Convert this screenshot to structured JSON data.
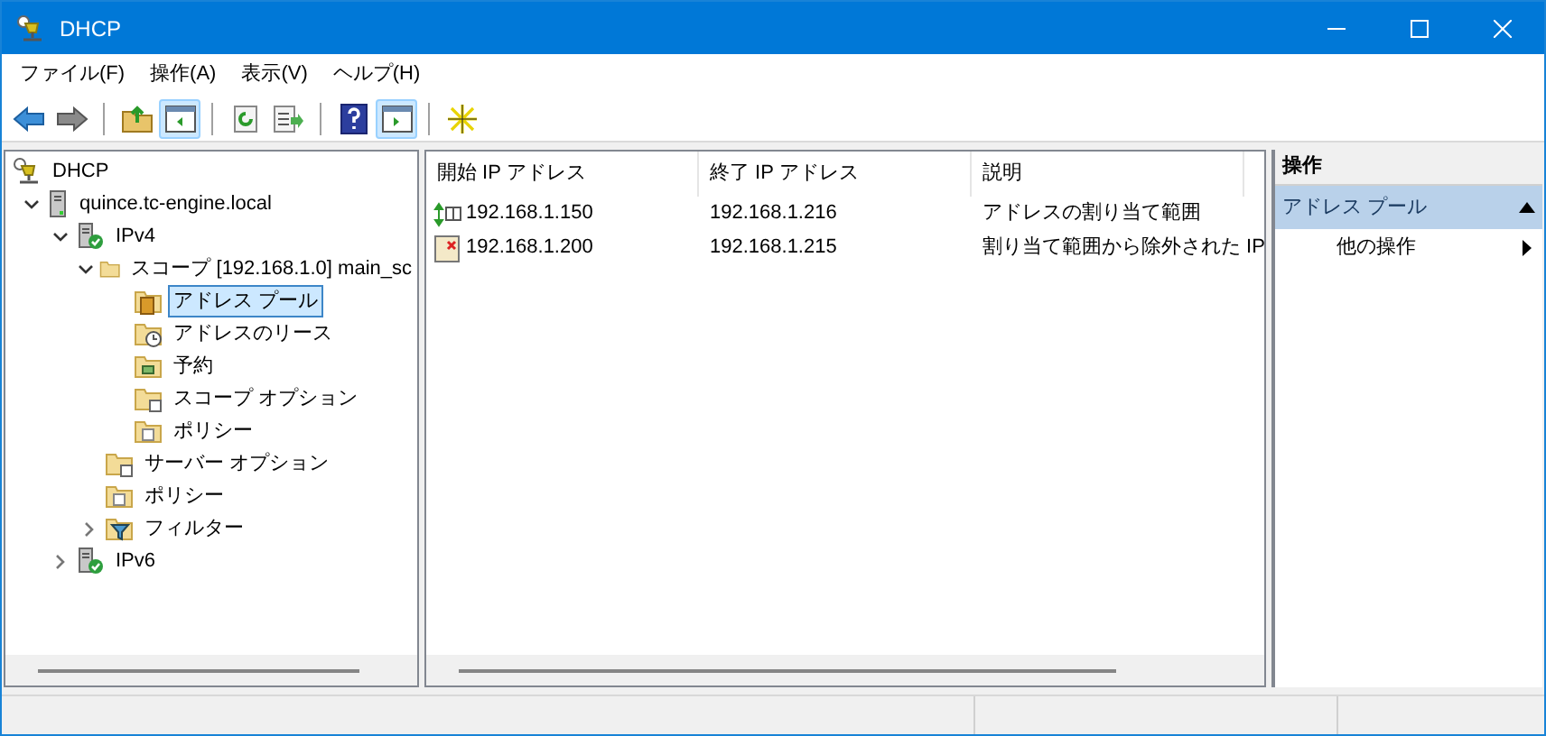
{
  "window": {
    "title": "DHCP"
  },
  "menu": [
    "ファイル(F)",
    "操作(A)",
    "表示(V)",
    "ヘルプ(H)"
  ],
  "toolbar": [
    {
      "kind": "back",
      "on": false
    },
    {
      "kind": "forward",
      "on": false
    },
    {
      "kind": "sep"
    },
    {
      "kind": "up",
      "on": false
    },
    {
      "kind": "tree",
      "on": true
    },
    {
      "kind": "sep"
    },
    {
      "kind": "refresh",
      "on": false
    },
    {
      "kind": "export",
      "on": false
    },
    {
      "kind": "sep"
    },
    {
      "kind": "help",
      "on": false
    },
    {
      "kind": "pane",
      "on": true
    },
    {
      "kind": "sep"
    },
    {
      "kind": "new",
      "on": false
    }
  ],
  "tree": [
    {
      "label": "DHCP",
      "kind": "root",
      "selected": false,
      "children": [
        {
          "label": "quince.tc-engine.local",
          "kind": "server",
          "expanded": true,
          "selected": false,
          "children": [
            {
              "label": "IPv4",
              "kind": "ipv",
              "expanded": true,
              "selected": false,
              "children": [
                {
                  "label": "スコープ [192.168.1.0] main_sc",
                  "kind": "scope",
                  "expanded": true,
                  "selected": false,
                  "children": [
                    {
                      "label": "アドレス プール",
                      "kind": "pool",
                      "selected": true
                    },
                    {
                      "label": "アドレスのリース",
                      "kind": "lease",
                      "selected": false
                    },
                    {
                      "label": "予約",
                      "kind": "reserve",
                      "selected": false
                    },
                    {
                      "label": "スコープ オプション",
                      "kind": "option",
                      "selected": false
                    },
                    {
                      "label": "ポリシー",
                      "kind": "policy",
                      "selected": false
                    }
                  ]
                },
                {
                  "label": "サーバー オプション",
                  "kind": "option",
                  "selected": false
                },
                {
                  "label": "ポリシー",
                  "kind": "policy",
                  "selected": false
                },
                {
                  "label": "フィルター",
                  "kind": "filter",
                  "expanded": false,
                  "selected": false
                }
              ]
            },
            {
              "label": "IPv6",
              "kind": "ipv",
              "expanded": false,
              "selected": false
            }
          ]
        }
      ]
    }
  ],
  "table": {
    "columns": [
      "開始 IP アドレス",
      "終了 IP アドレス",
      "説明"
    ],
    "rows": [
      {
        "kind": "range",
        "cells": [
          "192.168.1.150",
          "192.168.1.216",
          "アドレスの割り当て範囲"
        ]
      },
      {
        "kind": "exclusion",
        "cells": [
          "192.168.1.200",
          "192.168.1.215",
          "割り当て範囲から除外された IP"
        ]
      }
    ]
  },
  "actions": {
    "title": "操作",
    "section": {
      "label": "アドレス プール",
      "expanded": true
    },
    "items": [
      "他の操作"
    ]
  }
}
